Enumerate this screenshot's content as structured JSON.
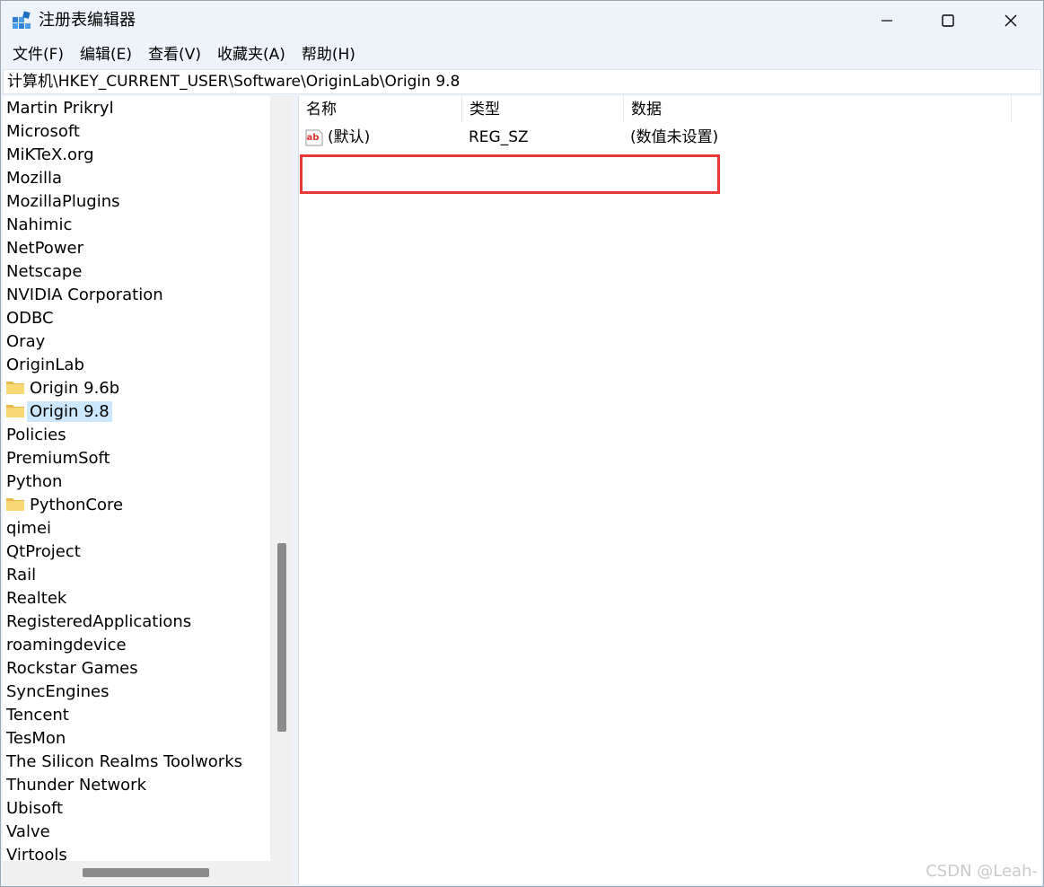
{
  "window": {
    "title": "注册表编辑器",
    "minimize_glyph": "—",
    "maximize_glyph": "□",
    "close_glyph": "✕"
  },
  "menu": {
    "items": [
      "文件(F)",
      "编辑(E)",
      "查看(V)",
      "收藏夹(A)",
      "帮助(H)"
    ]
  },
  "address": {
    "path": "计算机\\HKEY_CURRENT_USER\\Software\\OriginLab\\Origin 9.8"
  },
  "tree": {
    "items": [
      {
        "label": "Martin Prikryl",
        "folder": false,
        "selected": false
      },
      {
        "label": "Microsoft",
        "folder": false,
        "selected": false
      },
      {
        "label": "MiKTeX.org",
        "folder": false,
        "selected": false
      },
      {
        "label": "Mozilla",
        "folder": false,
        "selected": false
      },
      {
        "label": "MozillaPlugins",
        "folder": false,
        "selected": false
      },
      {
        "label": "Nahimic",
        "folder": false,
        "selected": false
      },
      {
        "label": "NetPower",
        "folder": false,
        "selected": false
      },
      {
        "label": "Netscape",
        "folder": false,
        "selected": false
      },
      {
        "label": "NVIDIA Corporation",
        "folder": false,
        "selected": false
      },
      {
        "label": "ODBC",
        "folder": false,
        "selected": false
      },
      {
        "label": "Oray",
        "folder": false,
        "selected": false
      },
      {
        "label": "OriginLab",
        "folder": false,
        "selected": false
      },
      {
        "label": "Origin 9.6b",
        "folder": true,
        "selected": false
      },
      {
        "label": "Origin 9.8",
        "folder": true,
        "selected": true
      },
      {
        "label": "Policies",
        "folder": false,
        "selected": false
      },
      {
        "label": "PremiumSoft",
        "folder": false,
        "selected": false
      },
      {
        "label": "Python",
        "folder": false,
        "selected": false
      },
      {
        "label": "PythonCore",
        "folder": true,
        "selected": false
      },
      {
        "label": "qimei",
        "folder": false,
        "selected": false
      },
      {
        "label": "QtProject",
        "folder": false,
        "selected": false
      },
      {
        "label": "Rail",
        "folder": false,
        "selected": false
      },
      {
        "label": "Realtek",
        "folder": false,
        "selected": false
      },
      {
        "label": "RegisteredApplications",
        "folder": false,
        "selected": false
      },
      {
        "label": "roamingdevice",
        "folder": false,
        "selected": false
      },
      {
        "label": "Rockstar Games",
        "folder": false,
        "selected": false
      },
      {
        "label": "SyncEngines",
        "folder": false,
        "selected": false
      },
      {
        "label": "Tencent",
        "folder": false,
        "selected": false
      },
      {
        "label": "TesMon",
        "folder": false,
        "selected": false
      },
      {
        "label": "The Silicon Realms Toolworks",
        "folder": false,
        "selected": false
      },
      {
        "label": "Thunder Network",
        "folder": false,
        "selected": false
      },
      {
        "label": "Ubisoft",
        "folder": false,
        "selected": false
      },
      {
        "label": "Valve",
        "folder": false,
        "selected": false
      },
      {
        "label": "Virtools",
        "folder": false,
        "selected": false
      }
    ]
  },
  "values_list": {
    "columns": [
      "名称",
      "类型",
      "数据"
    ],
    "rows": [
      {
        "name": "(默认)",
        "type": "REG_SZ",
        "data": "(数值未设置)",
        "icon": "string-value-icon"
      }
    ]
  },
  "colors": {
    "selection": "#cce8ff",
    "highlight_border": "#e53935",
    "folder": "#f8d775"
  },
  "watermark": "CSDN @Leah-"
}
